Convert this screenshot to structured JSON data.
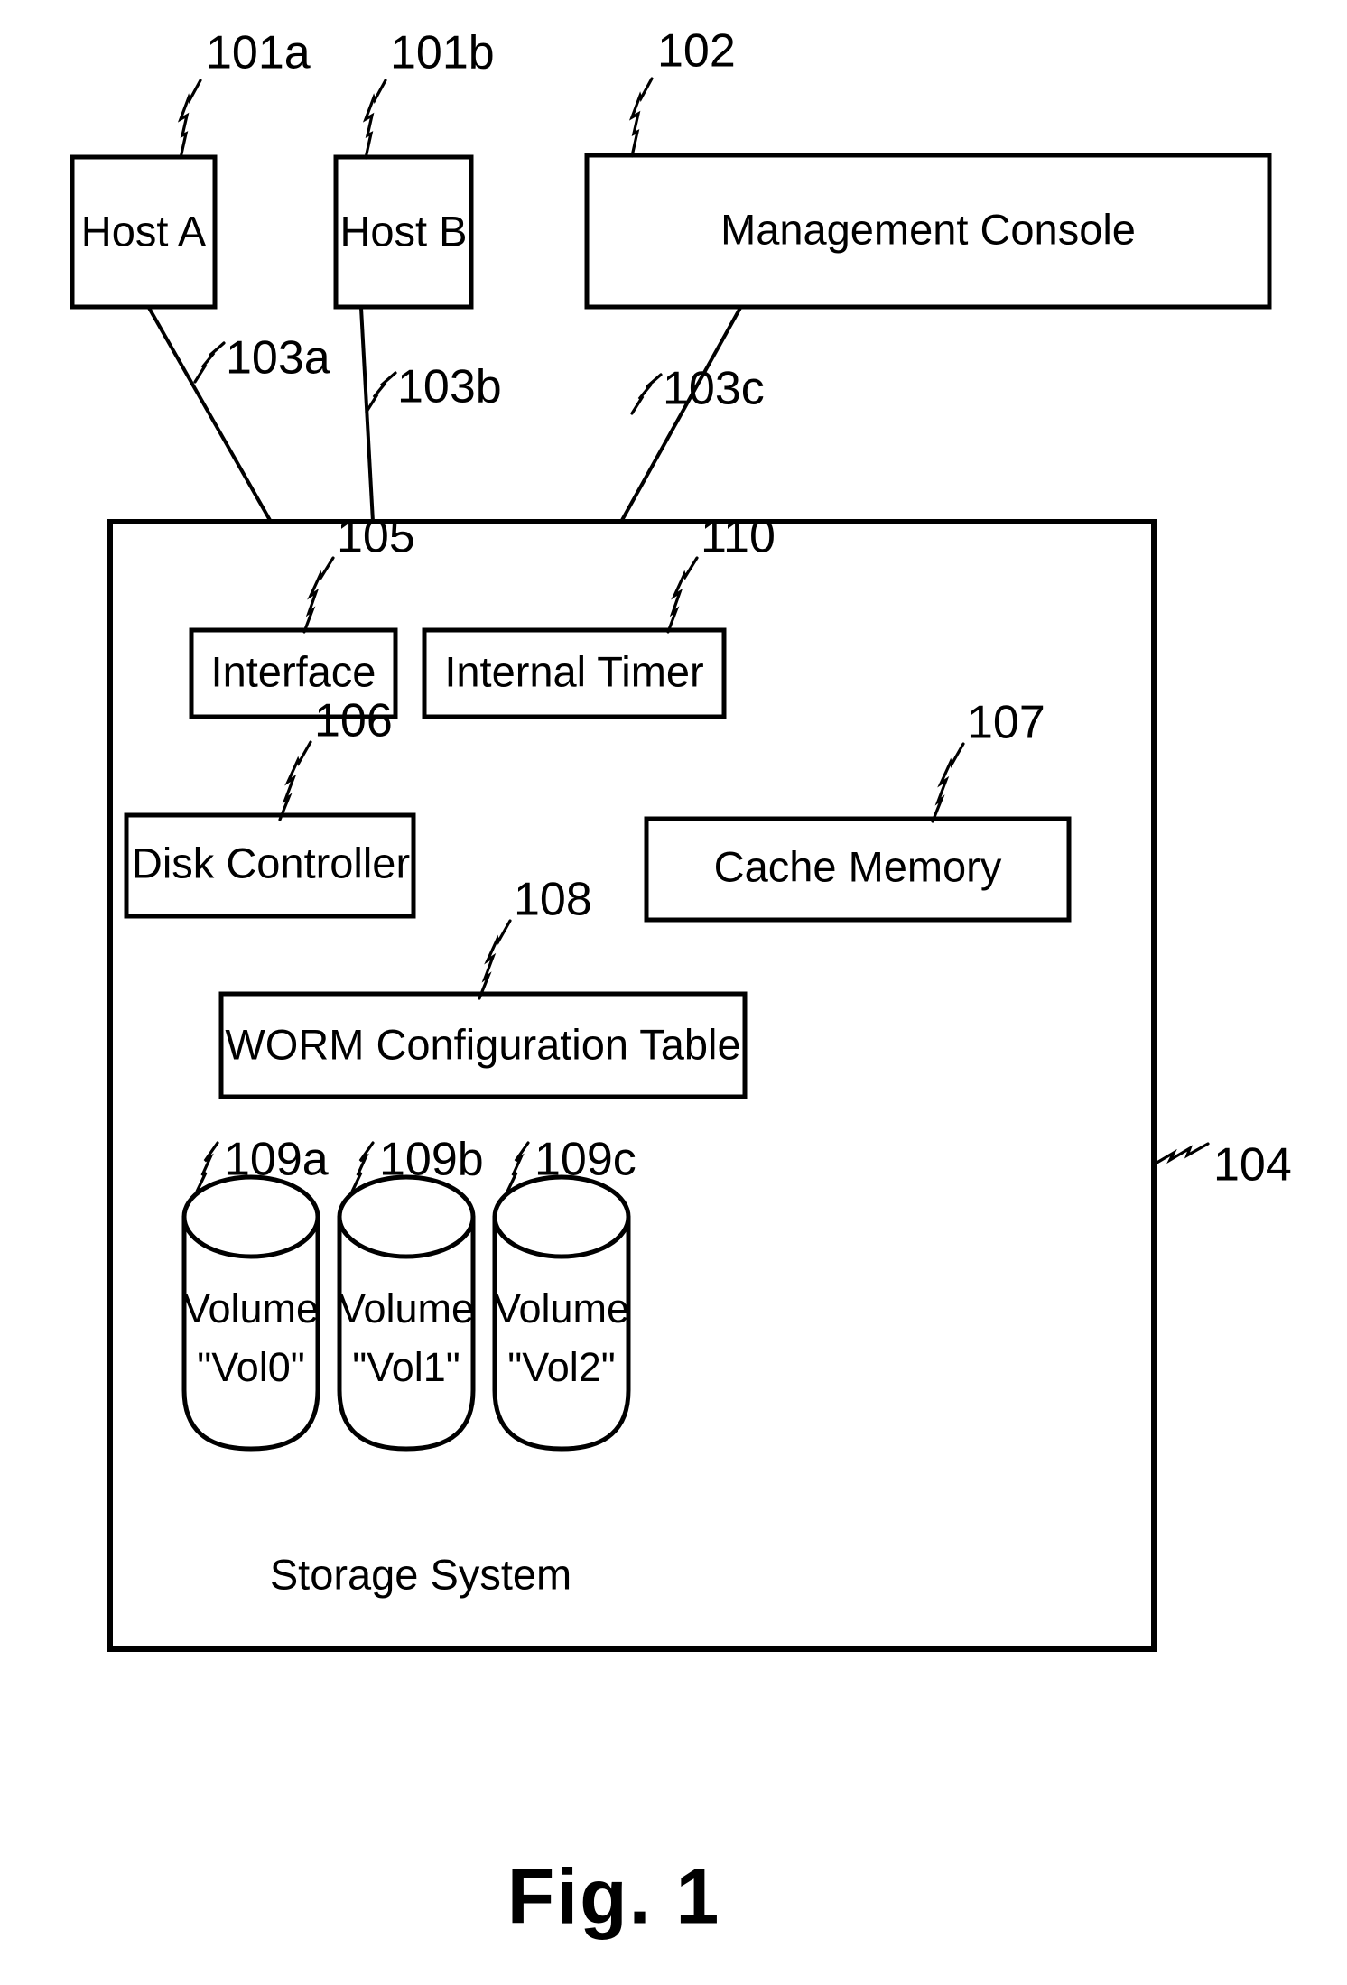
{
  "figure": {
    "caption": "Fig. 1",
    "domain_note": "patent block diagram"
  },
  "top_level_blocks": [
    {
      "id": "101a",
      "label": "Host A",
      "ref": "101a"
    },
    {
      "id": "101b",
      "label": "Host B",
      "ref": "101b"
    },
    {
      "id": "102",
      "label": "Management Console",
      "ref": "102"
    }
  ],
  "connections": [
    {
      "ref": "103a",
      "from": "Host A",
      "to": "Storage System"
    },
    {
      "ref": "103b",
      "from": "Host B",
      "to": "Storage System"
    },
    {
      "ref": "103c",
      "from": "Management Console",
      "to": "Storage System"
    }
  ],
  "storage_system": {
    "ref": "104",
    "label": "Storage System",
    "components": [
      {
        "id": "105",
        "label": "Interface",
        "ref": "105"
      },
      {
        "id": "110",
        "label": "Internal Timer",
        "ref": "110"
      },
      {
        "id": "106",
        "label": "Disk Controller",
        "ref": "106"
      },
      {
        "id": "107",
        "label": "Cache Memory",
        "ref": "107"
      },
      {
        "id": "108",
        "label": "WORM Configuration Table",
        "ref": "108"
      }
    ],
    "volumes": [
      {
        "ref": "109a",
        "line1": "Volume",
        "line2": "\"Vol0\""
      },
      {
        "ref": "109b",
        "line1": "Volume",
        "line2": "\"Vol1\""
      },
      {
        "ref": "109c",
        "line1": "Volume",
        "line2": "\"Vol2\""
      }
    ]
  },
  "colors": {
    "ink": "#000000",
    "paper": "#ffffff"
  }
}
